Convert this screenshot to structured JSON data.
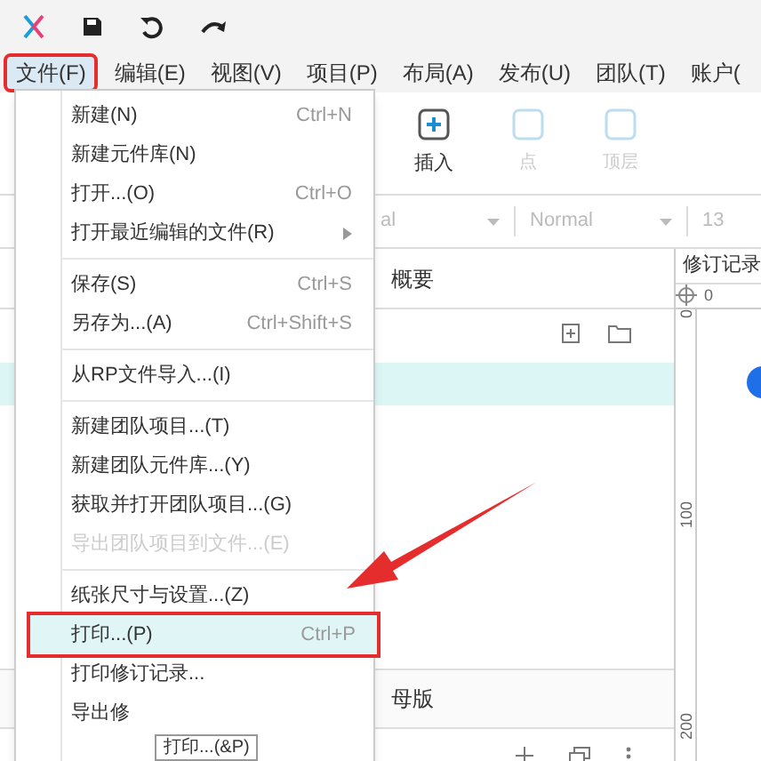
{
  "menubar": [
    {
      "label": "文件(F)",
      "selected": true
    },
    {
      "label": "编辑(E)",
      "selected": false
    },
    {
      "label": "视图(V)",
      "selected": false
    },
    {
      "label": "项目(P)",
      "selected": false
    },
    {
      "label": "布局(A)",
      "selected": false
    },
    {
      "label": "发布(U)",
      "selected": false
    },
    {
      "label": "团队(T)",
      "selected": false
    },
    {
      "label": "账户(",
      "selected": false
    }
  ],
  "toolbar": [
    {
      "label": "插入",
      "disabled": false
    },
    {
      "label": "点",
      "disabled": true
    },
    {
      "label": "顶层",
      "disabled": true
    }
  ],
  "format_bar": {
    "font": "al",
    "style": "Normal",
    "size": "13"
  },
  "pages_panel": {
    "title": "概要"
  },
  "masters_panel": {
    "title": "母版"
  },
  "revisions_panel": {
    "title": "修订记录",
    "ruler_h": [
      "0"
    ],
    "ruler_v": [
      "0",
      "100",
      "200"
    ]
  },
  "file_menu": [
    {
      "kind": "item",
      "label": "新建(N)",
      "shortcut": "Ctrl+N",
      "disabled": false,
      "selected": false
    },
    {
      "kind": "item",
      "label": "新建元件库(N)",
      "disabled": false,
      "selected": false
    },
    {
      "kind": "item",
      "label": "打开...(O)",
      "shortcut": "Ctrl+O",
      "disabled": false,
      "selected": false
    },
    {
      "kind": "submenu",
      "label": "打开最近编辑的文件(R)",
      "disabled": false,
      "selected": false
    },
    {
      "kind": "separator"
    },
    {
      "kind": "item",
      "label": "保存(S)",
      "shortcut": "Ctrl+S",
      "disabled": false,
      "selected": false
    },
    {
      "kind": "item",
      "label": "另存为...(A)",
      "shortcut": "Ctrl+Shift+S",
      "disabled": false,
      "selected": false
    },
    {
      "kind": "separator"
    },
    {
      "kind": "item",
      "label": "从RP文件导入...(I)",
      "disabled": false,
      "selected": false
    },
    {
      "kind": "separator"
    },
    {
      "kind": "item",
      "label": "新建团队项目...(T)",
      "disabled": false,
      "selected": false
    },
    {
      "kind": "item",
      "label": "新建团队元件库...(Y)",
      "disabled": false,
      "selected": false
    },
    {
      "kind": "item",
      "label": "获取并打开团队项目...(G)",
      "disabled": false,
      "selected": false
    },
    {
      "kind": "item",
      "label": "导出团队项目到文件...(E)",
      "disabled": true,
      "selected": false
    },
    {
      "kind": "separator"
    },
    {
      "kind": "item",
      "label": "纸张尺寸与设置...(Z)",
      "disabled": false,
      "selected": false
    },
    {
      "kind": "item",
      "label": "打印...(P)",
      "shortcut": "Ctrl+P",
      "disabled": false,
      "selected": true
    },
    {
      "kind": "item",
      "label": "打印修订记录...",
      "disabled": false,
      "selected": false
    },
    {
      "kind": "item",
      "label": "导出修",
      "disabled": false,
      "selected": false
    }
  ],
  "tooltip": "打印...(&P)"
}
